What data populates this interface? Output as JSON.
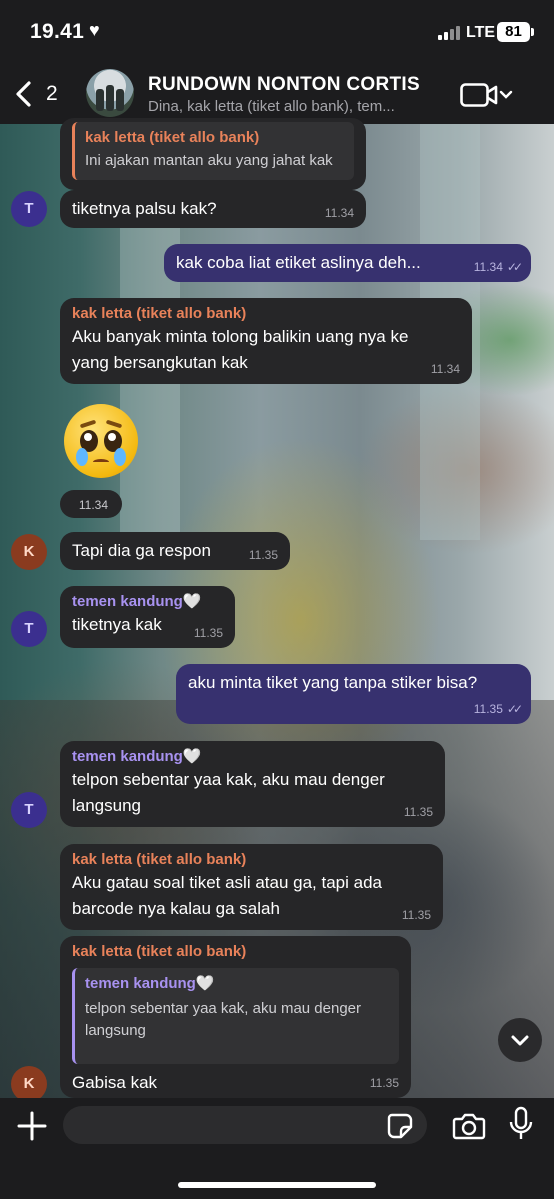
{
  "status": {
    "time": "19.41",
    "network": "LTE",
    "battery": "81"
  },
  "header": {
    "back_count": "2",
    "title": "RUNDOWN NONTON CORTIS",
    "subtitle": "Dina, kak letta (tiket allo bank), tem..."
  },
  "messages": {
    "m1": {
      "sender": "kak letta (tiket allo bank)",
      "text": "Ini ajakan mantan aku yang jahat kak"
    },
    "m2": {
      "avatar": "T",
      "text": "tiketnya palsu kak?",
      "time": "11.34"
    },
    "m3": {
      "text": "kak coba liat etiket aslinya deh...",
      "time": "11.34"
    },
    "m4": {
      "sender": "kak letta (tiket allo bank)",
      "line1": "Aku banyak minta tolong balikin uang nya ke",
      "line2": "yang bersangkutan kak",
      "time": "11.34"
    },
    "m5": {
      "emoji": "pleading-face",
      "time": "11.34"
    },
    "m6": {
      "avatar": "K",
      "text": "Tapi dia ga respon",
      "time": "11.35"
    },
    "m7": {
      "avatar": "T",
      "sender": "temen kandung🤍",
      "text": "tiketnya kak",
      "time": "11.35"
    },
    "m8": {
      "text": "aku minta tiket yang tanpa stiker bisa?",
      "time": "11.35"
    },
    "m9": {
      "avatar": "T",
      "sender": "temen kandung🤍",
      "line1": "telpon sebentar yaa kak, aku mau denger",
      "line2": "langsung",
      "time": "11.35"
    },
    "m10": {
      "sender": "kak letta (tiket allo bank)",
      "line1": "Aku gatau soal tiket asli atau ga, tapi ada",
      "line2": "barcode nya kalau ga salah",
      "time": "11.35"
    },
    "m11": {
      "avatar": "K",
      "sender": "kak letta (tiket allo bank)",
      "quote_sender": "temen kandung🤍",
      "quote_line1": "telpon sebentar yaa kak, aku mau denger",
      "quote_line2": "langsung",
      "text": "Gabisa kak",
      "time": "11.35"
    }
  },
  "input": {
    "placeholder": ""
  },
  "colors": {
    "outgoing": "#37316f",
    "incoming": "#262628",
    "sender_orange": "#e8825a",
    "sender_purple": "#a892f0"
  }
}
